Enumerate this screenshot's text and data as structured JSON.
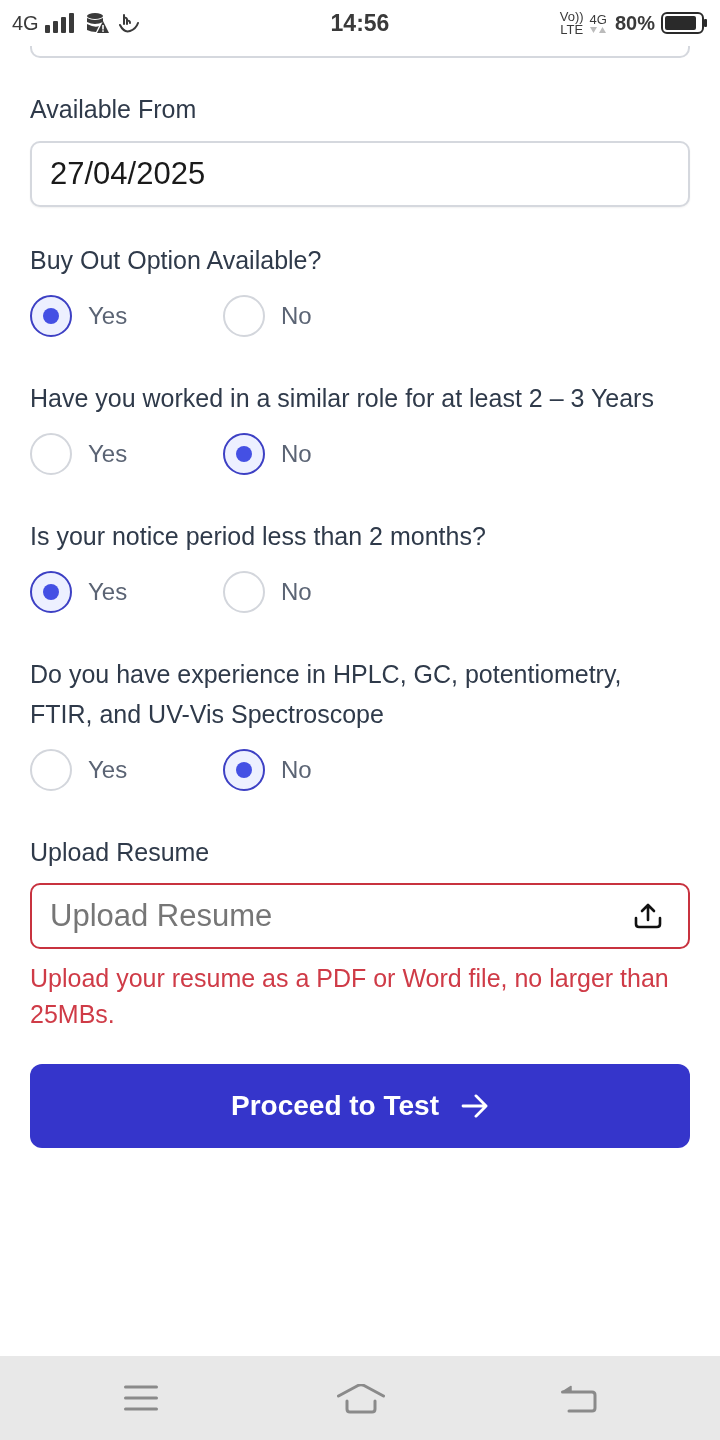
{
  "status_bar": {
    "network": "4G",
    "time": "14:56",
    "volte": "Vo))",
    "lte": "LTE",
    "data_type": "4G",
    "battery": "80%"
  },
  "form": {
    "available_from": {
      "label": "Available From",
      "value": "27/04/2025"
    },
    "questions": [
      {
        "label": "Buy Out Option Available?",
        "options": [
          {
            "label": "Yes",
            "selected": true
          },
          {
            "label": "No",
            "selected": false
          }
        ]
      },
      {
        "label": "Have you worked in a similar role for at least 2 – 3 Years",
        "options": [
          {
            "label": "Yes",
            "selected": false
          },
          {
            "label": "No",
            "selected": true
          }
        ]
      },
      {
        "label": "Is your notice period less than 2 months?",
        "options": [
          {
            "label": "Yes",
            "selected": true
          },
          {
            "label": "No",
            "selected": false
          }
        ]
      },
      {
        "label": "Do you have experience in HPLC, GC, potentiometry, FTIR, and UV-Vis Spectroscope",
        "options": [
          {
            "label": "Yes",
            "selected": false
          },
          {
            "label": "No",
            "selected": true
          }
        ]
      }
    ],
    "upload": {
      "label": "Upload Resume",
      "placeholder": "Upload Resume",
      "error": "Upload your resume as a PDF or Word file, no larger than 25MBs."
    },
    "submit": {
      "label": "Proceed to Test"
    }
  }
}
